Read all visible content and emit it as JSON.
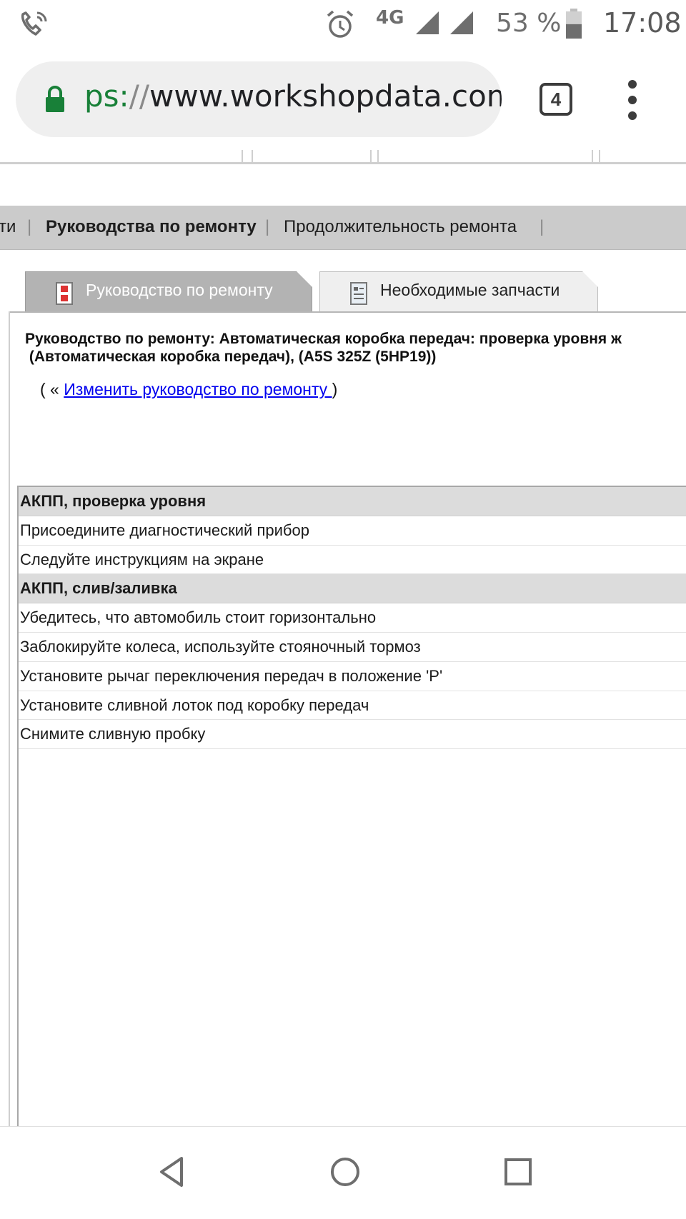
{
  "status_bar": {
    "network": "4G",
    "battery_percent": "53 %",
    "battery_level": 0.53,
    "time": "17:08",
    "icons": [
      "phone-call-icon",
      "alarm-icon",
      "signal-icon",
      "signal-icon",
      "battery-icon"
    ]
  },
  "browser": {
    "url_scheme": "ps:",
    "url_separator": "//",
    "url_host": "www.workshopdata.com",
    "tab_count": "4",
    "colors": {
      "secure": "#188038",
      "urlbar_bg": "#efefef"
    }
  },
  "nav": {
    "items": [
      {
        "label": "ти",
        "active": false
      },
      {
        "label": "Руководства по ремонту",
        "active": true
      },
      {
        "label": "Продолжительность ремонта",
        "active": false
      }
    ],
    "separator": "|"
  },
  "tabs": [
    {
      "label": "Руководство по ремонту",
      "active": true
    },
    {
      "label": "Необходимые запчасти",
      "active": false
    }
  ],
  "manual": {
    "title_line1": "Руководство по ремонту:  Автоматическая коробка передач: проверка уровня ж",
    "title_line2": " (Автоматическая коробка передач), (A5S 325Z (5HP19))",
    "change_prefix": "( «",
    "change_link": "Изменить руководство по ремонту ",
    "change_suffix": ")"
  },
  "steps": [
    {
      "text": "АКПП, проверка уровня",
      "header": true
    },
    {
      "text": "Присоедините диагностический прибор",
      "header": false
    },
    {
      "text": "Следуйте инструкциям на экране",
      "header": false
    },
    {
      "text": "АКПП, слив/заливка",
      "header": true
    },
    {
      "text": "Убедитесь, что автомобиль стоит горизонтально",
      "header": false
    },
    {
      "text": "Заблокируйте колеса, используйте стояночный тормоз",
      "header": false
    },
    {
      "text": "Установите рычаг переключения передач в положение 'P'",
      "header": false
    },
    {
      "text": "Установите сливной лоток под коробку передач",
      "header": false
    },
    {
      "text": "Снимите сливную пробку",
      "header": false
    }
  ]
}
